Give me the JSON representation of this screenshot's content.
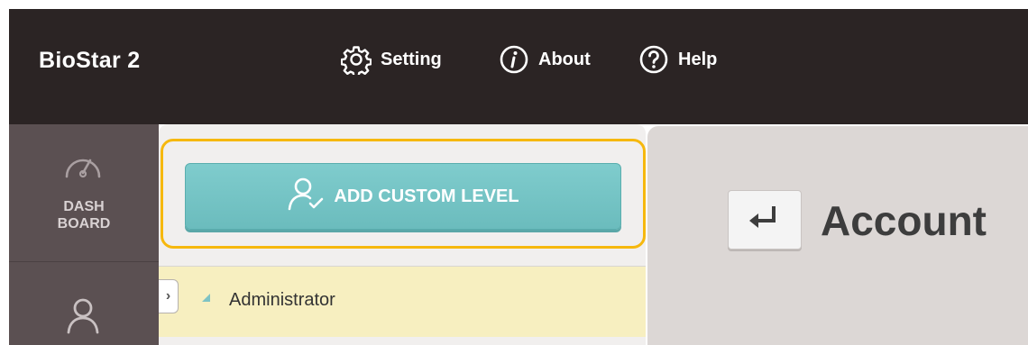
{
  "app": {
    "title": "BioStar 2"
  },
  "topnav": {
    "items": [
      {
        "label": "Setting",
        "icon": "gear-icon"
      },
      {
        "label": "About",
        "icon": "info-icon"
      },
      {
        "label": "Help",
        "icon": "help-icon"
      }
    ]
  },
  "sidebar": {
    "items": [
      {
        "label": "DASH\nBOARD",
        "icon": "gauge-icon"
      },
      {
        "label": "",
        "icon": "user-icon"
      }
    ]
  },
  "level_panel": {
    "add_button_label": "ADD CUSTOM LEVEL",
    "add_button_icon": "user-check-icon",
    "tree": [
      {
        "label": "Administrator",
        "expanded": true,
        "selected": true
      }
    ],
    "toggle_glyph": "›"
  },
  "detail_panel": {
    "back_icon": "return-arrow-icon",
    "title": "Account"
  },
  "colors": {
    "topbar": "#2b2424",
    "sidebar": "#5b5052",
    "accent_button": "#72c4c5",
    "highlight_ring": "#f6b80e",
    "selected_row": "#f7efc0"
  }
}
